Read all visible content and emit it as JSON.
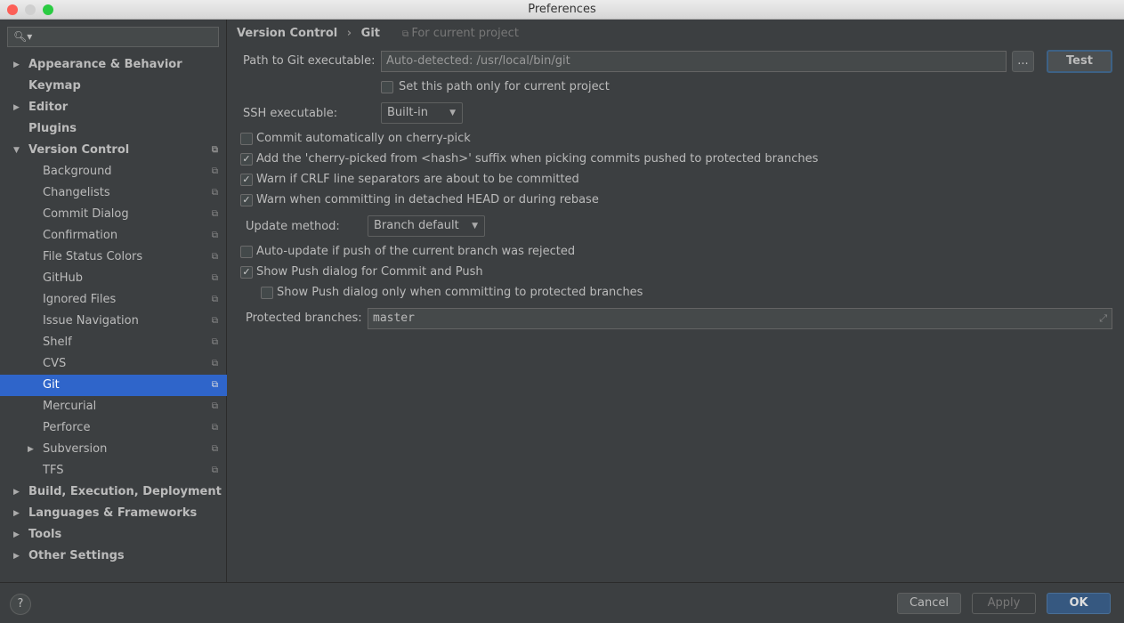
{
  "window": {
    "title": "Preferences"
  },
  "sidebar": {
    "search_placeholder": "",
    "items": [
      {
        "label": "Appearance & Behavior",
        "level": 0,
        "bold": true,
        "arrow": "▶"
      },
      {
        "label": "Keymap",
        "level": 0,
        "bold": true,
        "arrow": ""
      },
      {
        "label": "Editor",
        "level": 0,
        "bold": true,
        "arrow": "▶"
      },
      {
        "label": "Plugins",
        "level": 0,
        "bold": true,
        "arrow": ""
      },
      {
        "label": "Version Control",
        "level": 0,
        "bold": true,
        "arrow": "▼",
        "proj": true
      },
      {
        "label": "Background",
        "level": 1,
        "proj": true
      },
      {
        "label": "Changelists",
        "level": 1,
        "proj": true
      },
      {
        "label": "Commit Dialog",
        "level": 1,
        "proj": true
      },
      {
        "label": "Confirmation",
        "level": 1,
        "proj": true
      },
      {
        "label": "File Status Colors",
        "level": 1,
        "proj": true
      },
      {
        "label": "GitHub",
        "level": 1,
        "proj": true
      },
      {
        "label": "Ignored Files",
        "level": 1,
        "proj": true
      },
      {
        "label": "Issue Navigation",
        "level": 1,
        "proj": true
      },
      {
        "label": "Shelf",
        "level": 1,
        "proj": true
      },
      {
        "label": "CVS",
        "level": 1,
        "proj": true
      },
      {
        "label": "Git",
        "level": 1,
        "proj": true,
        "selected": true
      },
      {
        "label": "Mercurial",
        "level": 1,
        "proj": true
      },
      {
        "label": "Perforce",
        "level": 1,
        "proj": true
      },
      {
        "label": "Subversion",
        "level": 1,
        "proj": true,
        "arrow": "▶"
      },
      {
        "label": "TFS",
        "level": 1,
        "proj": true
      },
      {
        "label": "Build, Execution, Deployment",
        "level": 0,
        "bold": true,
        "arrow": "▶"
      },
      {
        "label": "Languages & Frameworks",
        "level": 0,
        "bold": true,
        "arrow": "▶"
      },
      {
        "label": "Tools",
        "level": 0,
        "bold": true,
        "arrow": "▶"
      },
      {
        "label": "Other Settings",
        "level": 0,
        "bold": true,
        "arrow": "▶"
      }
    ]
  },
  "breadcrumb": {
    "parent": "Version Control",
    "sep": "›",
    "current": "Git",
    "scope": "For current project"
  },
  "git": {
    "path_label": "Path to Git executable:",
    "path_value": "Auto-detected: /usr/local/bin/git",
    "browse": "...",
    "test": "Test",
    "path_only_project": {
      "label": "Set this path only for current project",
      "checked": false
    },
    "ssh_label": "SSH executable:",
    "ssh_value": "Built-in",
    "options": [
      {
        "label": "Commit automatically on cherry-pick",
        "checked": false
      },
      {
        "label": "Add the 'cherry-picked from <hash>' suffix when picking commits pushed to protected branches",
        "checked": true
      },
      {
        "label": "Warn if CRLF line separators are about to be committed",
        "checked": true
      },
      {
        "label": "Warn when committing in detached HEAD or during rebase",
        "checked": true
      }
    ],
    "update_label": "Update method:",
    "update_value": "Branch default",
    "options2": [
      {
        "label": "Auto-update if push of the current branch was rejected",
        "checked": false
      },
      {
        "label": "Show Push dialog for Commit and Push",
        "checked": true
      },
      {
        "label": "Show Push dialog only when committing to protected branches",
        "checked": false
      }
    ],
    "protected_label": "Protected branches:",
    "protected_value": "master"
  },
  "footer": {
    "help": "?",
    "cancel": "Cancel",
    "apply": "Apply",
    "ok": "OK"
  },
  "colors": {
    "selection": "#2f65ca",
    "ok": "#365880",
    "focus": "#3d6185"
  }
}
